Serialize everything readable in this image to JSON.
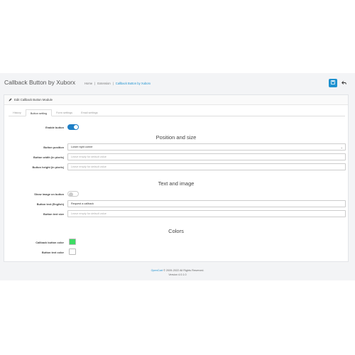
{
  "header": {
    "title": "Callback Button by Xuborx",
    "breadcrumb": [
      "Home",
      "|",
      "Extension",
      "|",
      "Callback Button by Xuborx"
    ],
    "save_icon": "save-icon",
    "back_icon": "back-arrow-icon"
  },
  "panel": {
    "heading": "Edit Callback Button Module",
    "tabs": [
      "History",
      "Button setting",
      "Form settings",
      "Email settings"
    ],
    "active_tab": "Button setting"
  },
  "button_settings": {
    "enable_label": "Enable button",
    "enable_state": "on"
  },
  "position_section": {
    "title": "Position and size",
    "position_label": "Button position",
    "position_value": "Lower right corner",
    "width_label": "Button width (in pixels)",
    "width_placeholder": "Leave empty for default value",
    "height_label": "Button height (in pixels)",
    "height_placeholder": "Leave empty for default value"
  },
  "text_section": {
    "title": "Text and image",
    "show_image_label": "Show image on button",
    "show_image_state": "off",
    "text_label": "Button text (English)",
    "text_value": "Request a callback",
    "size_label": "Button text size",
    "size_placeholder": "Leave empty for default value"
  },
  "colors_section": {
    "title": "Colors",
    "bg_label": "Callback button color",
    "bg_color": "#3ddc64",
    "text_color_label": "Button text color",
    "text_color": "#ffffff"
  },
  "footer": {
    "brand": "OpenCart",
    "copyright": "© 2009-2022 All Rights Reserved.",
    "version": "Version 4.0.1.0"
  },
  "colors": {
    "accent": "#1e91cf",
    "background": "#f3f4f6"
  }
}
